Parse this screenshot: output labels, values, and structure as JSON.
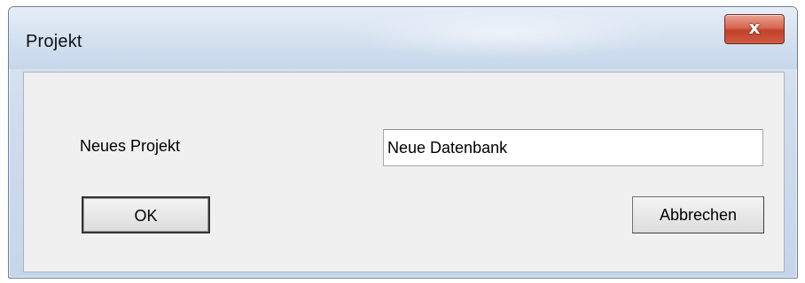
{
  "window": {
    "title": "Projekt",
    "close_label": "x"
  },
  "form": {
    "label": "Neues Projekt",
    "input_value": "Neue Datenbank"
  },
  "buttons": {
    "ok_label": "OK",
    "cancel_label": "Abbrechen"
  }
}
